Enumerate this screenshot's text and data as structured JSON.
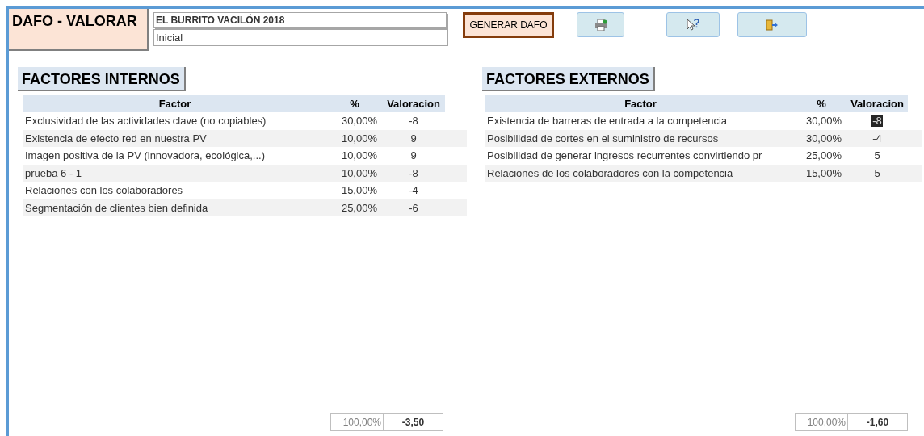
{
  "header": {
    "title": "DAFO - VALORAR",
    "project": "EL BURRITO VACILÓN 2018",
    "version": "Inicial",
    "generate_button": "GENERAR DAFO"
  },
  "internal": {
    "heading": "FACTORES INTERNOS",
    "columns": [
      "Factor",
      "%",
      "Valoracion"
    ],
    "rows": [
      {
        "factor": "Exclusividad de las actividades clave (no copiables)",
        "percent": "30,00%",
        "rating": "-8",
        "selected": false
      },
      {
        "factor": "Existencia de efecto red en nuestra PV",
        "percent": "10,00%",
        "rating": "9",
        "selected": false
      },
      {
        "factor": "Imagen positiva de la PV (innovadora, ecológica,...)",
        "percent": "10,00%",
        "rating": "9",
        "selected": false
      },
      {
        "factor": "prueba 6 - 1",
        "percent": "10,00%",
        "rating": "-8",
        "selected": false
      },
      {
        "factor": "Relaciones con los colaboradores",
        "percent": "15,00%",
        "rating": "-4",
        "selected": false
      },
      {
        "factor": "Segmentación de clientes bien definida",
        "percent": "25,00%",
        "rating": "-6",
        "selected": false
      }
    ],
    "total_percent": "100,00%",
    "total_rating": "-3,50"
  },
  "external": {
    "heading": "FACTORES EXTERNOS",
    "columns": [
      "Factor",
      "%",
      "Valoracion"
    ],
    "rows": [
      {
        "factor": "Existencia de barreras de entrada a la competencia",
        "percent": "30,00%",
        "rating": "-8",
        "selected": true
      },
      {
        "factor": "Posibilidad de cortes en el suministro de recursos",
        "percent": "30,00%",
        "rating": "-4",
        "selected": false
      },
      {
        "factor": "Posibilidad de generar ingresos recurrentes convirtiendo pr",
        "percent": "25,00%",
        "rating": "5",
        "selected": false
      },
      {
        "factor": "Relaciones de los colaboradores con la competencia",
        "percent": "15,00%",
        "rating": "5",
        "selected": false
      }
    ],
    "total_percent": "100,00%",
    "total_rating": "-1,60"
  }
}
